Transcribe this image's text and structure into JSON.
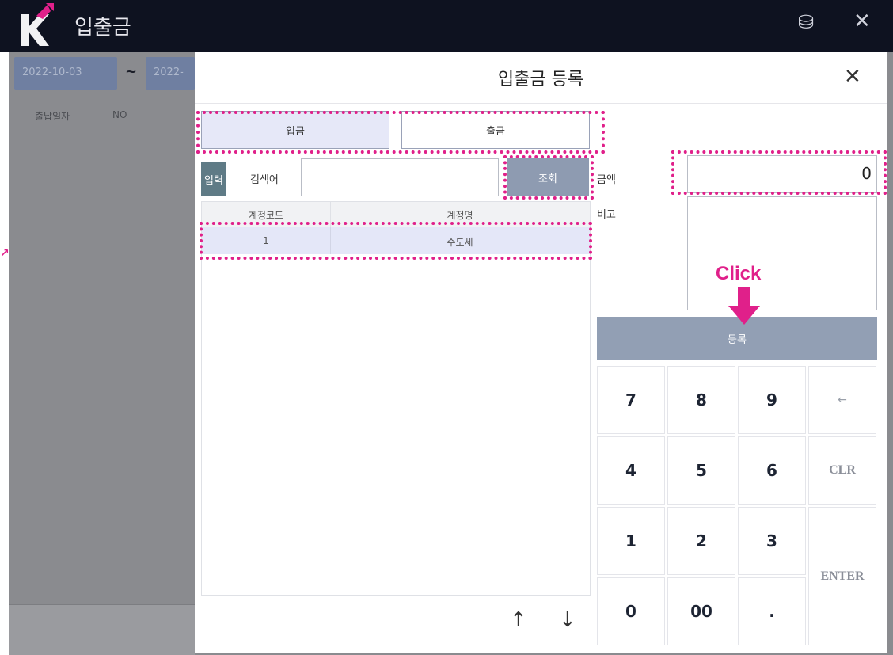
{
  "app": {
    "title": "입출금",
    "date_start": "2022-10-03",
    "date_separator": "~",
    "date_end_partial": "2022-",
    "columns": [
      "출납일자",
      "NO"
    ]
  },
  "modal": {
    "title": "입출금 등록",
    "toggle": {
      "deposit": "입금",
      "withdraw": "출금"
    },
    "input_button": "입력",
    "search_label": "검색어",
    "search_value": "",
    "lookup_button": "조회",
    "table": {
      "headers": [
        "계정코드",
        "계정명"
      ],
      "rows": [
        {
          "code": "1",
          "name": "수도세"
        }
      ]
    },
    "amount_label": "금액",
    "amount_value": "0",
    "note_label": "비고",
    "register_button": "등록",
    "keypad": {
      "k7": "7",
      "k8": "8",
      "k9": "9",
      "back": "←",
      "k4": "4",
      "k5": "5",
      "k6": "6",
      "clr": "CLR",
      "k1": "1",
      "k2": "2",
      "k3": "3",
      "enter": "ENTER",
      "k0": "0",
      "k00": "00",
      "dot": "."
    },
    "nav": {
      "up": "↑",
      "down": "↓"
    }
  },
  "annotation": {
    "hint": "Click",
    "color": "#e0208a"
  },
  "colors": {
    "titlebar": "#0e1220",
    "accent_button": "#929fb4",
    "toggle_selected": "#e6e8f8"
  }
}
